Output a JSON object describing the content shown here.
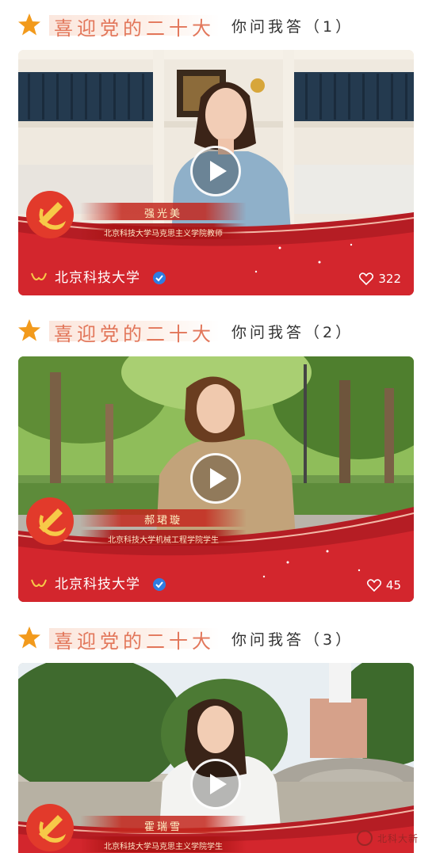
{
  "sections": [
    {
      "title": "喜迎党的二十大",
      "subtitle": "你问我答（1）",
      "person_name": "强光美",
      "person_org": "北京科技大学马克思主义学院教师",
      "brand": "北京科技大学",
      "verified": true,
      "likes": "322"
    },
    {
      "title": "喜迎党的二十大",
      "subtitle": "你问我答（2）",
      "person_name": "郝珺璇",
      "person_org": "北京科技大学机械工程学院学生",
      "brand": "北京科技大学",
      "verified": true,
      "likes": "45"
    },
    {
      "title": "喜迎党的二十大",
      "subtitle": "你问我答（3）",
      "person_name": "霍瑞雪",
      "person_org": "北京科技大学马克思主义学院学生",
      "brand": "",
      "verified": false,
      "likes": ""
    }
  ],
  "watermark": {
    "text": "北科大新",
    "icon": "university-seal-icon"
  },
  "icons": {
    "star": "star-icon",
    "play": "play-icon",
    "like": "heart-icon",
    "verified": "verified-badge-icon",
    "brand_logo": "ustb-logo-icon",
    "emblem": "party-emblem-icon"
  },
  "colors": {
    "title": "#e2765a",
    "ribbon": "#c8242b",
    "verified": "#2f7de1",
    "star": "#f29a1c"
  }
}
